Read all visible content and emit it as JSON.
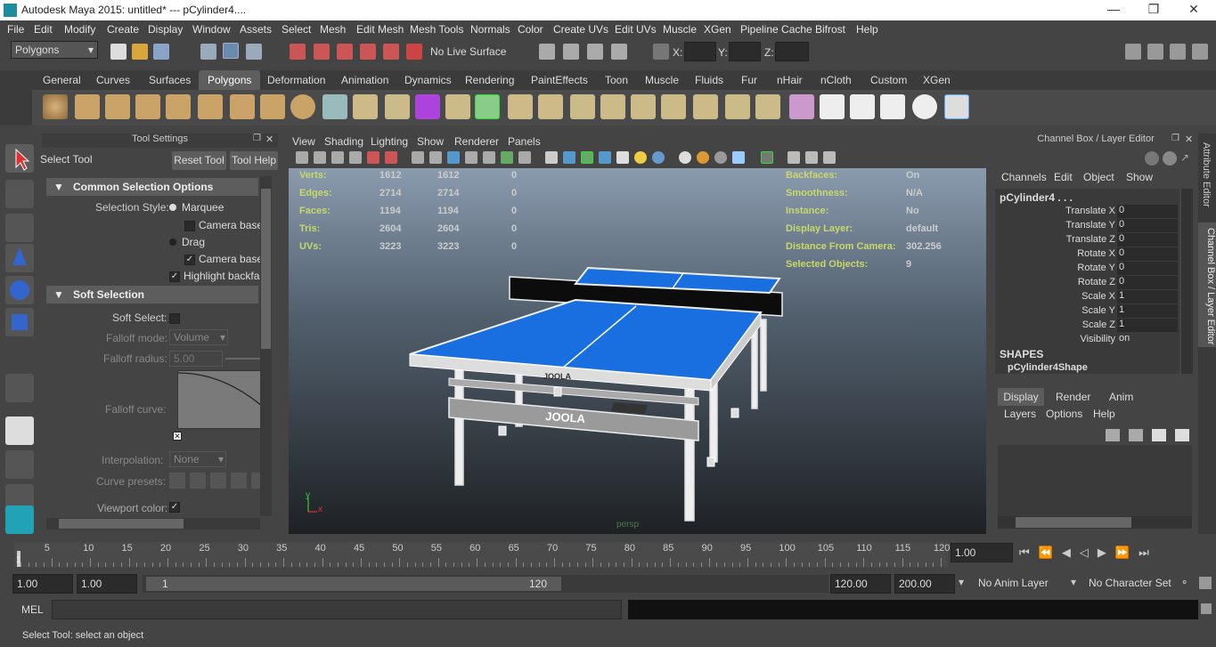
{
  "window": {
    "title": "Autodesk Maya 2015: untitled*   ---   pCylinder4...."
  },
  "menus": [
    "File",
    "Edit",
    "Modify",
    "Create",
    "Display",
    "Window",
    "Assets",
    "Select",
    "Mesh",
    "Edit Mesh",
    "Mesh Tools",
    "Normals",
    "Color",
    "Create UVs",
    "Edit UVs",
    "Muscle",
    "XGen",
    "Pipeline Cache",
    "Bifrost",
    "Help"
  ],
  "status": {
    "mode": "Polygons",
    "live_surface": "No Live Surface",
    "x_label": "X:",
    "y_label": "Y:",
    "z_label": "Z:"
  },
  "shelf_tabs": [
    "General",
    "Curves",
    "Surfaces",
    "Polygons",
    "Deformation",
    "Animation",
    "Dynamics",
    "Rendering",
    "PaintEffects",
    "Toon",
    "Muscle",
    "Fluids",
    "Fur",
    "nHair",
    "nCloth",
    "Custom",
    "XGen"
  ],
  "tool_settings": {
    "title": "Tool Settings",
    "tool": "Select Tool",
    "reset": "Reset Tool",
    "help": "Tool Help",
    "common": "Common Selection Options",
    "sel_style": "Selection Style:",
    "marquee": "Marquee",
    "camera_based1": "Camera based",
    "drag": "Drag",
    "camera_based2": "Camera based",
    "highlight": "Highlight backface",
    "soft": "Soft Selection",
    "soft_select": "Soft Select:",
    "falloff_mode": "Falloff mode:",
    "falloff_mode_val": "Volume",
    "falloff_radius": "Falloff radius:",
    "falloff_radius_val": "5.00",
    "falloff_curve": "Falloff curve:",
    "interp": "Interpolation:",
    "interp_val": "None",
    "presets": "Curve presets:",
    "vp_color": "Viewport color:"
  },
  "viewport": {
    "menus": [
      "View",
      "Shading",
      "Lighting",
      "Show",
      "Renderer",
      "Panels"
    ],
    "camera": "persp",
    "hud_left": [
      {
        "k": "Verts:",
        "a": "1612",
        "b": "1612",
        "c": "0"
      },
      {
        "k": "Edges:",
        "a": "2714",
        "b": "2714",
        "c": "0"
      },
      {
        "k": "Faces:",
        "a": "1194",
        "b": "1194",
        "c": "0"
      },
      {
        "k": "Tris:",
        "a": "2604",
        "b": "2604",
        "c": "0"
      },
      {
        "k": "UVs:",
        "a": "3223",
        "b": "3223",
        "c": "0"
      }
    ],
    "hud_right": [
      {
        "k": "Backfaces:",
        "v": "On"
      },
      {
        "k": "Smoothness:",
        "v": "N/A"
      },
      {
        "k": "Instance:",
        "v": "No"
      },
      {
        "k": "Display Layer:",
        "v": "default"
      },
      {
        "k": "Distance From Camera:",
        "v": "302.256"
      },
      {
        "k": "Selected Objects:",
        "v": "9"
      }
    ],
    "brand": "JOOLA",
    "axis_x": "x",
    "axis_y": "y"
  },
  "channel_box": {
    "title": "Channel Box / Layer Editor",
    "menus": [
      "Channels",
      "Edit",
      "Object",
      "Show"
    ],
    "object": "pCylinder4 . . .",
    "attrs": [
      {
        "k": "Translate X",
        "v": "0"
      },
      {
        "k": "Translate Y",
        "v": "0"
      },
      {
        "k": "Translate Z",
        "v": "0"
      },
      {
        "k": "Rotate X",
        "v": "0"
      },
      {
        "k": "Rotate Y",
        "v": "0"
      },
      {
        "k": "Rotate Z",
        "v": "0"
      },
      {
        "k": "Scale X",
        "v": "1"
      },
      {
        "k": "Scale Y",
        "v": "1"
      },
      {
        "k": "Scale Z",
        "v": "1"
      },
      {
        "k": "Visibility",
        "v": "on"
      }
    ],
    "shapes": "SHAPES",
    "shape": "pCylinder4Shape",
    "layer_tabs": [
      "Display",
      "Render",
      "Anim"
    ],
    "layer_menus": [
      "Layers",
      "Options",
      "Help"
    ],
    "side1": "Attribute Editor",
    "side2": "Channel Box / Layer Editor"
  },
  "timeline": {
    "ticks": [
      "1",
      "5",
      "10",
      "15",
      "20",
      "25",
      "30",
      "35",
      "40",
      "45",
      "50",
      "55",
      "60",
      "65",
      "70",
      "75",
      "80",
      "85",
      "90",
      "95",
      "100",
      "105",
      "110",
      "115",
      "120"
    ],
    "current": "1.00"
  },
  "range": {
    "start": "1.00",
    "start2": "1.00",
    "slider_start": "1",
    "slider_end": "120",
    "end": "120.00",
    "end2": "200.00",
    "anim_layer": "No Anim Layer",
    "char_set": "No Character Set"
  },
  "mel": {
    "label": "MEL"
  },
  "help": "Select Tool: select an object",
  "colors": {
    "accent": "#5285a6",
    "table": "#1a6fe0",
    "hud": "#c8d86a"
  }
}
